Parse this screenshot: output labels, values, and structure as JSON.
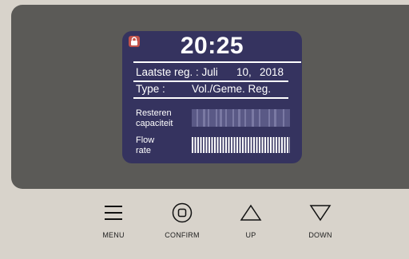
{
  "display": {
    "time": "20:25",
    "last_reg_label": "Laatste reg. : Juli",
    "last_reg_day": "10,",
    "last_reg_year": "2018",
    "type_label": "Type :",
    "type_value": "Vol./Geme. Reg.",
    "remaining_label_1": "Resteren",
    "remaining_label_2": "capaciteit",
    "flow_label_1": "Flow",
    "flow_label_2": "rate",
    "lock_icon": "lock-icon"
  },
  "buttons": [
    {
      "label": "MENU",
      "icon": "menu-icon"
    },
    {
      "label": "CONFIRM",
      "icon": "confirm-icon"
    },
    {
      "label": "UP",
      "icon": "up-arrow-icon"
    },
    {
      "label": "DOWN",
      "icon": "down-arrow-icon"
    }
  ],
  "colors": {
    "screen": "#35335f",
    "lock": "#c2524a",
    "bezel": "#5b5a57",
    "panel": "#d8d3cb"
  }
}
